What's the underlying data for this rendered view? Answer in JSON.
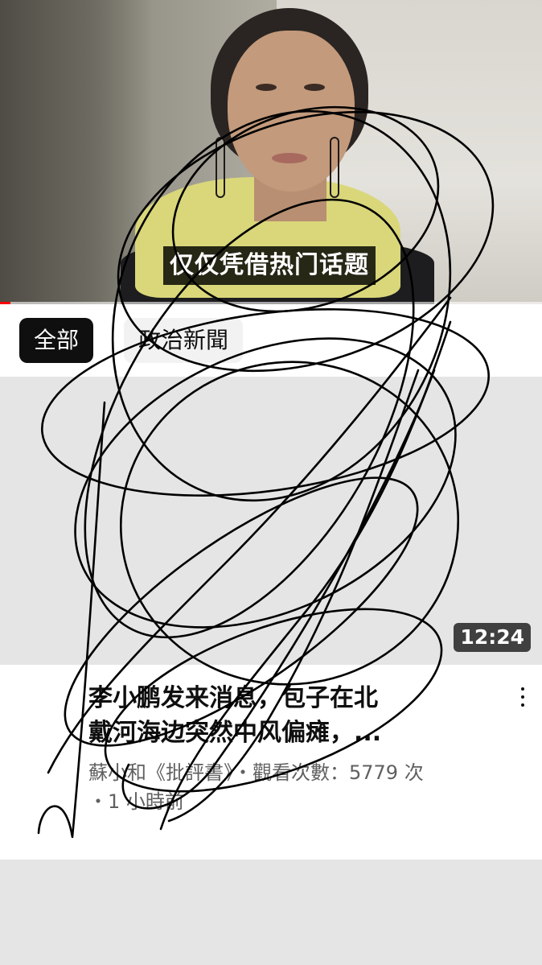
{
  "player": {
    "subtitle": "仅仅凭借热门话题",
    "progress": 0.02,
    "progress_color": "#ff0000"
  },
  "chips": [
    {
      "label": "全部",
      "selected": true
    },
    {
      "label": "政治新聞",
      "selected": false
    }
  ],
  "video": {
    "duration": "12:24",
    "title_lines": [
      "李小鹏发来消息，包子在北",
      "戴河海边突然中风偏瘫，..."
    ],
    "meta_lines": [
      "蘇小和《批評書》・觀看次數：5779 次",
      "・1 小時前"
    ],
    "menu_icon": "more-vert-icon"
  },
  "overlay": {
    "type": "hand-drawn scribble",
    "color": "#000000"
  }
}
